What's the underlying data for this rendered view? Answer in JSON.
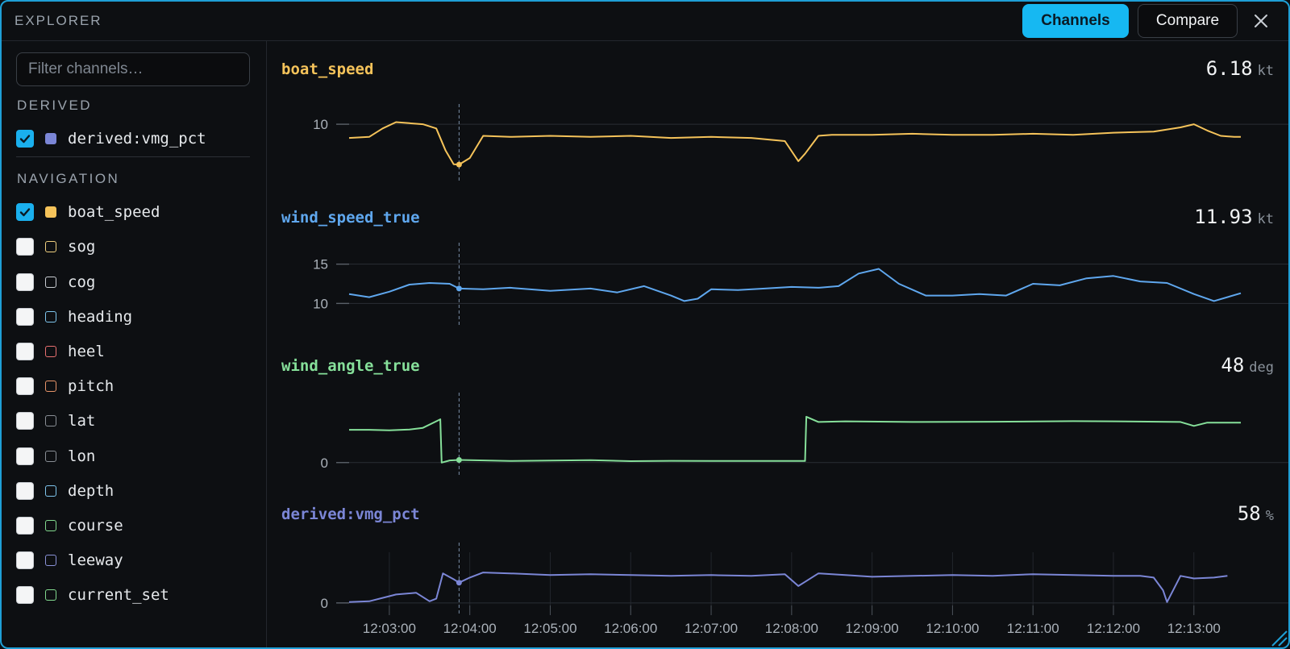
{
  "header": {
    "title": "EXPLORER",
    "channels_label": "Channels",
    "compare_label": "Compare",
    "close_icon": "close-icon"
  },
  "sidebar": {
    "filter_placeholder": "Filter channels…",
    "sections": [
      {
        "title": "DERIVED",
        "items": [
          {
            "label": "derived:vmg_pct",
            "checked": true,
            "color": "#7b86d6"
          }
        ]
      },
      {
        "title": "NAVIGATION",
        "items": [
          {
            "label": "boat_speed",
            "checked": true,
            "color": "#f5c35a"
          },
          {
            "label": "sog",
            "checked": false,
            "color": "#f0d080"
          },
          {
            "label": "cog",
            "checked": false,
            "color": "#c9cdd3"
          },
          {
            "label": "heading",
            "checked": false,
            "color": "#7fc6ee"
          },
          {
            "label": "heel",
            "checked": false,
            "color": "#e87070"
          },
          {
            "label": "pitch",
            "checked": false,
            "color": "#e8956a"
          },
          {
            "label": "lat",
            "checked": false,
            "color": "#8a8f96"
          },
          {
            "label": "lon",
            "checked": false,
            "color": "#8a8f96"
          },
          {
            "label": "depth",
            "checked": false,
            "color": "#7fc6ee"
          },
          {
            "label": "course",
            "checked": false,
            "color": "#82d98e"
          },
          {
            "label": "leeway",
            "checked": false,
            "color": "#8a92d8"
          },
          {
            "label": "current_set",
            "checked": false,
            "color": "#82d98e"
          }
        ]
      }
    ]
  },
  "cursor_time": "12:03:52",
  "chart_data": [
    {
      "type": "line",
      "title": "boat_speed",
      "value": "6.18",
      "unit": "kt",
      "color": "#f5c35a",
      "yticks": [
        10
      ],
      "ylim": [
        5.5,
        11
      ],
      "x": [
        "12:02:30",
        "12:02:45",
        "12:02:55",
        "12:03:05",
        "12:03:15",
        "12:03:25",
        "12:03:35",
        "12:03:42",
        "12:03:48",
        "12:03:52",
        "12:04:00",
        "12:04:10",
        "12:04:30",
        "12:05:00",
        "12:05:30",
        "12:06:00",
        "12:06:30",
        "12:07:00",
        "12:07:30",
        "12:07:55",
        "12:08:05",
        "12:08:10",
        "12:08:20",
        "12:08:30",
        "12:09:00",
        "12:09:30",
        "12:10:00",
        "12:10:30",
        "12:11:00",
        "12:11:30",
        "12:12:00",
        "12:12:30",
        "12:12:50",
        "12:13:00",
        "12:13:10",
        "12:13:20",
        "12:13:30",
        "12:13:35"
      ],
      "y": [
        8.7,
        8.8,
        9.6,
        10.2,
        10.1,
        10.0,
        9.6,
        7.5,
        6.2,
        6.18,
        6.8,
        8.9,
        8.8,
        8.9,
        8.8,
        8.9,
        8.7,
        8.8,
        8.7,
        8.4,
        6.5,
        7.2,
        8.9,
        9.0,
        9.0,
        9.1,
        9.0,
        9.0,
        9.1,
        9.0,
        9.2,
        9.3,
        9.7,
        10.0,
        9.4,
        8.9,
        8.8,
        8.8
      ]
    },
    {
      "type": "line",
      "title": "wind_speed_true",
      "value": "11.93",
      "unit": "kt",
      "color": "#5fa7ee",
      "yticks": [
        10,
        15
      ],
      "ylim": [
        8.5,
        16.5
      ],
      "x": [
        "12:02:30",
        "12:02:45",
        "12:03:00",
        "12:03:15",
        "12:03:30",
        "12:03:45",
        "12:03:52",
        "12:04:10",
        "12:04:30",
        "12:05:00",
        "12:05:30",
        "12:05:50",
        "12:06:10",
        "12:06:30",
        "12:06:40",
        "12:06:50",
        "12:07:00",
        "12:07:20",
        "12:07:40",
        "12:08:00",
        "12:08:20",
        "12:08:35",
        "12:08:50",
        "12:09:05",
        "12:09:20",
        "12:09:40",
        "12:10:00",
        "12:10:20",
        "12:10:40",
        "12:11:00",
        "12:11:20",
        "12:11:40",
        "12:12:00",
        "12:12:20",
        "12:12:40",
        "12:13:00",
        "12:13:15",
        "12:13:35"
      ],
      "y": [
        11.2,
        10.8,
        11.5,
        12.4,
        12.6,
        12.5,
        11.9,
        11.8,
        12.0,
        11.6,
        11.9,
        11.4,
        12.2,
        11.0,
        10.3,
        10.6,
        11.8,
        11.7,
        11.9,
        12.1,
        12.0,
        12.2,
        13.8,
        14.4,
        12.5,
        11.0,
        11.0,
        11.2,
        11.0,
        12.5,
        12.3,
        13.2,
        13.5,
        12.8,
        12.6,
        11.2,
        10.3,
        11.3
      ]
    },
    {
      "type": "line",
      "title": "wind_angle_true",
      "value": "48",
      "unit": "deg",
      "color": "#86e09a",
      "yticks": [
        0
      ],
      "ylim": [
        -2,
        46
      ],
      "x": [
        "12:02:30",
        "12:02:45",
        "12:03:00",
        "12:03:15",
        "12:03:25",
        "12:03:38",
        "12:03:39",
        "12:03:45",
        "12:03:52",
        "12:04:30",
        "12:05:30",
        "12:06:00",
        "12:06:30",
        "12:07:00",
        "12:07:30",
        "12:08:00",
        "12:08:10",
        "12:08:11",
        "12:08:20",
        "12:08:40",
        "12:09:30",
        "12:10:30",
        "12:11:30",
        "12:12:00",
        "12:12:50",
        "12:13:00",
        "12:13:10",
        "12:13:35"
      ],
      "y": [
        25,
        25,
        24.6,
        25.2,
        26.5,
        33,
        0,
        1.6,
        2,
        1.2,
        1.8,
        1.1,
        1.3,
        1.2,
        1.2,
        1.2,
        1.2,
        35,
        31,
        31.5,
        31,
        31.2,
        31.6,
        31.5,
        31,
        28,
        30.5,
        30.5
      ]
    },
    {
      "type": "line",
      "title": "derived:vmg_pct",
      "value": "58",
      "unit": "%",
      "color": "#7b86d6",
      "yticks": [
        0
      ],
      "ylim": [
        -3,
        60
      ],
      "x": [
        "12:02:30",
        "12:02:45",
        "12:03:00",
        "12:03:05",
        "12:03:20",
        "12:03:30",
        "12:03:35",
        "12:03:40",
        "12:03:48",
        "12:03:52",
        "12:04:00",
        "12:04:10",
        "12:04:30",
        "12:05:00",
        "12:05:30",
        "12:06:00",
        "12:06:30",
        "12:07:00",
        "12:07:30",
        "12:07:55",
        "12:08:05",
        "12:08:10",
        "12:08:20",
        "12:08:40",
        "12:09:00",
        "12:09:30",
        "12:10:00",
        "12:10:30",
        "12:11:00",
        "12:11:30",
        "12:12:00",
        "12:12:20",
        "12:12:30",
        "12:12:37",
        "12:12:40",
        "12:12:50",
        "12:13:00",
        "12:13:15",
        "12:13:25"
      ],
      "y": [
        1,
        2,
        8,
        10,
        12,
        2,
        5,
        35,
        28,
        24,
        30,
        36,
        35,
        33,
        34,
        33,
        32,
        33,
        32,
        34,
        20,
        25,
        35,
        33,
        31,
        32,
        33,
        32,
        34,
        33,
        32,
        32,
        30,
        15,
        1,
        32,
        29,
        30,
        32
      ]
    }
  ],
  "x_axis": {
    "ticks": [
      "12:03:00",
      "12:04:00",
      "12:05:00",
      "12:06:00",
      "12:07:00",
      "12:08:00",
      "12:09:00",
      "12:10:00",
      "12:11:00",
      "12:12:00",
      "12:13:00"
    ],
    "start": "12:02:30",
    "end": "12:13:35"
  }
}
